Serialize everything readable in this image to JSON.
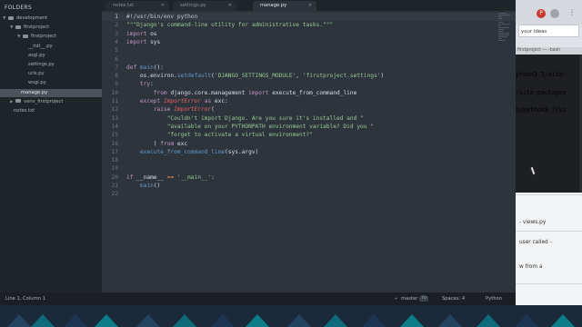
{
  "sidebar": {
    "title": "FOLDERS",
    "items": [
      {
        "label": "development",
        "indent": 0,
        "kind": "folder-open"
      },
      {
        "label": "firstproject",
        "indent": 1,
        "kind": "folder-open"
      },
      {
        "label": "firstproject",
        "indent": 2,
        "kind": "folder-open"
      },
      {
        "label": "__init__.py",
        "indent": 3,
        "kind": "file"
      },
      {
        "label": "asgi.py",
        "indent": 3,
        "kind": "file"
      },
      {
        "label": "settings.py",
        "indent": 3,
        "kind": "file"
      },
      {
        "label": "urls.py",
        "indent": 3,
        "kind": "file"
      },
      {
        "label": "wsgi.py",
        "indent": 3,
        "kind": "file"
      },
      {
        "label": "manage.py",
        "indent": 2,
        "kind": "file",
        "selected": true
      },
      {
        "label": "venv_firstproject",
        "indent": 1,
        "kind": "folder-closed"
      },
      {
        "label": "notes.txt",
        "indent": 1,
        "kind": "file"
      }
    ]
  },
  "tabs": [
    {
      "label": "notes.txt",
      "active": false
    },
    {
      "label": "settings.py",
      "active": false
    },
    {
      "label": "manage.py",
      "active": true
    }
  ],
  "tab_close_glyph": "×",
  "code": [
    [
      [
        "cm",
        "#!/usr/bin/env python"
      ]
    ],
    [
      [
        "st",
        "\"\"\"Django's command-line utility for administrative tasks.\"\"\""
      ]
    ],
    [
      [
        "kw",
        "import"
      ],
      [
        "pl",
        " os"
      ]
    ],
    [
      [
        "kw",
        "import"
      ],
      [
        "pl",
        " sys"
      ]
    ],
    [],
    [],
    [
      [
        "kw",
        "def"
      ],
      [
        "pl",
        " "
      ],
      [
        "fn",
        "main"
      ],
      [
        "pl",
        "():"
      ]
    ],
    [
      [
        "pl",
        "    os.environ."
      ],
      [
        "fn",
        "setdefault"
      ],
      [
        "pl",
        "("
      ],
      [
        "st",
        "'DJANGO_SETTINGS_MODULE'"
      ],
      [
        "pl",
        ", "
      ],
      [
        "st",
        "'firstproject.settings'"
      ],
      [
        "pl",
        ")"
      ]
    ],
    [
      [
        "pl",
        "    "
      ],
      [
        "kw",
        "try"
      ],
      [
        "pl",
        ":"
      ]
    ],
    [
      [
        "pl",
        "        "
      ],
      [
        "kw",
        "from"
      ],
      [
        "pl",
        " django.core.management "
      ],
      [
        "kw",
        "import"
      ],
      [
        "pl",
        " execute_from_command_line"
      ]
    ],
    [
      [
        "pl",
        "    "
      ],
      [
        "kw",
        "except"
      ],
      [
        "pl",
        " "
      ],
      [
        "it",
        "ImportError"
      ],
      [
        "pl",
        " "
      ],
      [
        "kw",
        "as"
      ],
      [
        "pl",
        " exc:"
      ]
    ],
    [
      [
        "pl",
        "        "
      ],
      [
        "kw",
        "raise"
      ],
      [
        "pl",
        " "
      ],
      [
        "it",
        "ImportError"
      ],
      [
        "pl",
        "("
      ]
    ],
    [
      [
        "pl",
        "            "
      ],
      [
        "st",
        "\"Couldn't import Django. Are you sure it's installed and \""
      ]
    ],
    [
      [
        "pl",
        "            "
      ],
      [
        "st",
        "\"available on your PYTHONPATH environment variable? Did you \""
      ]
    ],
    [
      [
        "pl",
        "            "
      ],
      [
        "st",
        "\"forget to activate a virtual environment?\""
      ]
    ],
    [
      [
        "pl",
        "        ) "
      ],
      [
        "kw",
        "from"
      ],
      [
        "pl",
        " exc"
      ]
    ],
    [
      [
        "pl",
        "    "
      ],
      [
        "fn",
        "execute_from_command_line"
      ],
      [
        "pl",
        "(sys.argv)"
      ]
    ],
    [],
    [],
    [
      [
        "kw",
        "if"
      ],
      [
        "pl",
        " __name__ "
      ],
      [
        "op",
        "=="
      ],
      [
        "pl",
        " "
      ],
      [
        "st",
        "'__main__'"
      ],
      [
        "pl",
        ":"
      ]
    ],
    [
      [
        "pl",
        "    "
      ],
      [
        "fn",
        "main"
      ],
      [
        "pl",
        "()"
      ]
    ],
    []
  ],
  "status": {
    "position": "Line 1, Column 1",
    "branch": "master",
    "branch_badge": "70",
    "spaces": "Spaces: 4",
    "syntax": "Python"
  },
  "browser": {
    "url_text": "your ideas"
  },
  "terminal": {
    "title": "firstproject — -bash",
    "lines": [
      {
        "text": "ython3.7/site-",
        "color": "#3fbf3f"
      },
      {
        "text": "/site-packages",
        "color": "#3fbf3f"
      },
      {
        "text": "b/python3.7/si",
        "color": "#3fbf3f"
      },
      {
        "text": "",
        "color": "#3fbf3f"
      }
    ]
  },
  "doc": {
    "lines": [
      "- views.py",
      "user called -",
      "w from a"
    ]
  },
  "colors": {
    "editor_bg": "#2d343b",
    "sidebar_bg": "#1f2428",
    "keyword": "#c594c5",
    "function": "#6699cc",
    "string": "#99c794",
    "builtin": "#ec5f66"
  }
}
